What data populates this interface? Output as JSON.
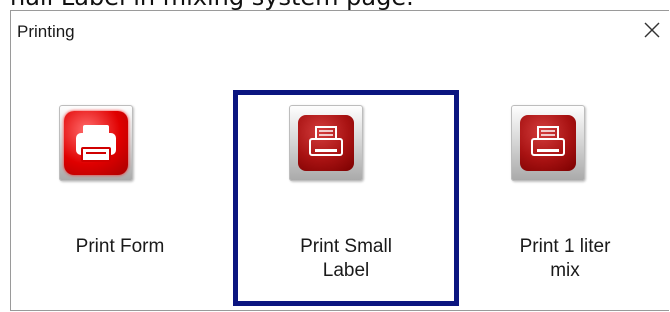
{
  "caption": "nall Label in mixing system page.",
  "dialog": {
    "title": "Printing",
    "close_glyph": "✕"
  },
  "options": [
    {
      "label": "Print Form",
      "icon": "printer-icon",
      "selected": false
    },
    {
      "label": "Print Small\nLabel",
      "icon": "printer-icon",
      "selected": true
    },
    {
      "label": "Print 1 liter\nmix",
      "icon": "printer-icon",
      "selected": false
    }
  ],
  "colors": {
    "selection_border": "#0b1580",
    "icon_red_bright": "#e00000",
    "icon_red_dark": "#a81212"
  }
}
